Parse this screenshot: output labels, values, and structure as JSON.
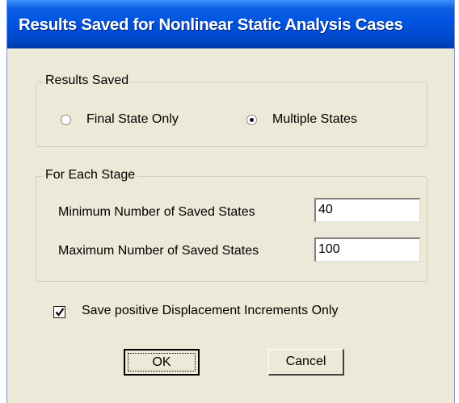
{
  "dialog": {
    "title": "Results Saved for Nonlinear Static Analysis Cases"
  },
  "results_saved": {
    "legend": "Results Saved",
    "options": [
      {
        "label": "Final State Only",
        "selected": false
      },
      {
        "label": "Multiple States",
        "selected": true
      }
    ]
  },
  "for_each_stage": {
    "legend": "For Each Stage",
    "min_label": "Minimum Number of Saved States",
    "min_value": "40",
    "max_label": "Maximum Number of Saved States",
    "max_value": "100"
  },
  "save_positive": {
    "label": "Save positive Displacement Increments Only",
    "checked": true
  },
  "buttons": {
    "ok": "OK",
    "cancel": "Cancel"
  },
  "colors": {
    "titlebar": "#0054e3",
    "dialog_bg": "#ece9d8"
  }
}
